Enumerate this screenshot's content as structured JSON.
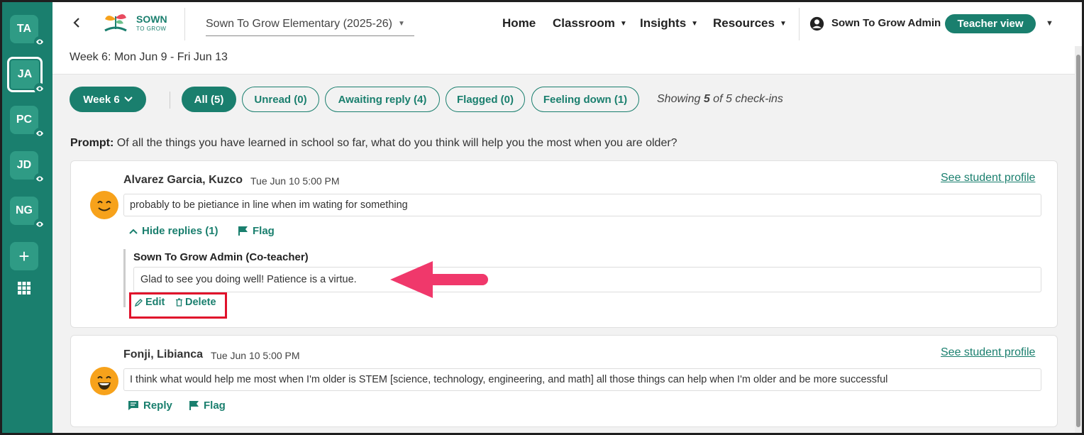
{
  "rail": {
    "items": [
      {
        "initials": "TA"
      },
      {
        "initials": "JA",
        "active": true
      },
      {
        "initials": "PC"
      },
      {
        "initials": "JD"
      },
      {
        "initials": "NG"
      }
    ],
    "add_label": "+"
  },
  "header": {
    "logo_line1": "SOWN",
    "logo_line2": "TO GROW",
    "school": "Sown To Grow Elementary (2025-26)",
    "nav": [
      "Home",
      "Classroom",
      "Insights",
      "Resources"
    ],
    "user_name": "Sown To Grow Admin",
    "view_button": "Teacher view"
  },
  "week_bar": {
    "text": "Week 6: Mon Jun 9 - Fri Jun 13"
  },
  "filters": {
    "week_button": "Week 6",
    "pills": [
      "All (5)",
      "Unread (0)",
      "Awaiting reply (4)",
      "Flagged (0)",
      "Feeling down (1)"
    ],
    "showing_prefix": "Showing ",
    "showing_count": "5",
    "showing_suffix": " of 5 check-ins"
  },
  "prompt": {
    "label": "Prompt:",
    "text": " Of all the things you have learned in school so far, what do you think will help you the most when you are older?"
  },
  "checkins": [
    {
      "student": "Alvarez Garcia, Kuzco",
      "time": "Tue Jun 10 5:00 PM",
      "profile_link": "See student profile",
      "answer": "probably to be pietiance in line when im wating for something",
      "replies_toggle": "Hide replies (1)",
      "flag": "Flag",
      "reply": {
        "author": "Sown To Grow Admin (Co-teacher)",
        "text": "Glad to see you doing well! Patience is a virtue.",
        "edit": "Edit",
        "delete": "Delete"
      }
    },
    {
      "student": "Fonji, Libianca",
      "time": "Tue Jun 10 5:00 PM",
      "profile_link": "See student profile",
      "answer": "I think what would help me most when I'm older is STEM [science, technology, engineering, and math] all those things can help when I'm older and be more successful",
      "reply_action": "Reply",
      "flag": "Flag"
    }
  ],
  "colors": {
    "brand": "#1a7f6e",
    "highlight_box": "#e0112b",
    "arrow": "#f0386b",
    "emoji": "#f7a21b"
  }
}
